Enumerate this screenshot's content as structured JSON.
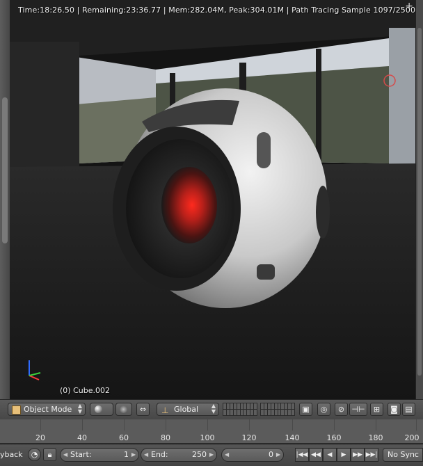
{
  "viewport": {
    "stats": "Time:18:26.50 | Remaining:23:36.77 | Mem:282.04M, Peak:304.01M | Path Tracing Sample 1097/2500",
    "object_label": "(0) Cube.002"
  },
  "header": {
    "mode": "Object Mode",
    "orientation": "Global"
  },
  "timeline": {
    "ticks": [
      "20",
      "40",
      "60",
      "80",
      "100",
      "120",
      "140",
      "160",
      "180",
      "200"
    ],
    "playback_label": "yback",
    "start_label": "Start:",
    "start_value": "1",
    "end_label": "End:",
    "end_value": "250",
    "current_frame": "0",
    "sync": "No Sync"
  },
  "colors": {
    "panel": "#474747",
    "accent_red": "#e0302a",
    "sky": "#d8dde4"
  }
}
